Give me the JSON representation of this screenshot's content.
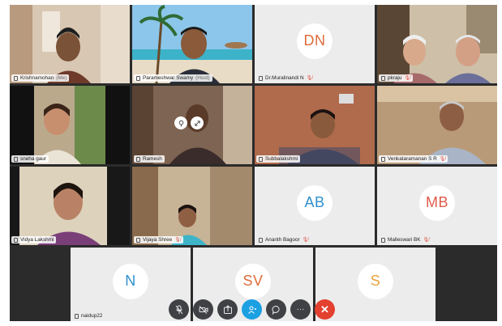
{
  "meeting": {
    "participants": [
      {
        "name": "Krishnamohan",
        "tag": "(Me)",
        "muted": false
      },
      {
        "name": "Parameshwar Swamy",
        "tag": "(Host)",
        "muted": false
      },
      {
        "name": "Dr.Muralinandi N",
        "initials": "DN",
        "initials_color": "#e06b3b",
        "muted": true
      },
      {
        "name": "pkraju",
        "muted": true
      },
      {
        "name": "sneha gaur",
        "muted": false
      },
      {
        "name": "Ramesh",
        "muted": false
      },
      {
        "name": "Subbalakshmi",
        "muted": false
      },
      {
        "name": "Venkataramanan S R",
        "muted": true
      },
      {
        "name": "Vidya Lakshmi",
        "muted": false
      },
      {
        "name": "Vijaya Shree",
        "muted": true
      },
      {
        "name": "Ananth Bagoor",
        "initials": "AB",
        "initials_color": "#2f8fce",
        "muted": true
      },
      {
        "name": "Malleswari BK",
        "initials": "MB",
        "initials_color": "#e05b4a",
        "muted": true
      },
      {
        "name": "naidup22",
        "initials": "N",
        "initials_color": "#2f8fce",
        "muted": false
      },
      {
        "initials": "SV",
        "initials_color": "#e06b3b"
      },
      {
        "initials": "S",
        "initials_color": "#e9a23b"
      }
    ]
  },
  "toolbar": {
    "buttons": [
      "microphone-off",
      "video-off",
      "share-screen",
      "participants",
      "chat",
      "more-options",
      "end-call"
    ],
    "end_label": "✕",
    "more_label": "···"
  },
  "colors": {
    "accent": "#1ba0e2",
    "end": "#e3402f",
    "muted": "#e04a3a"
  }
}
